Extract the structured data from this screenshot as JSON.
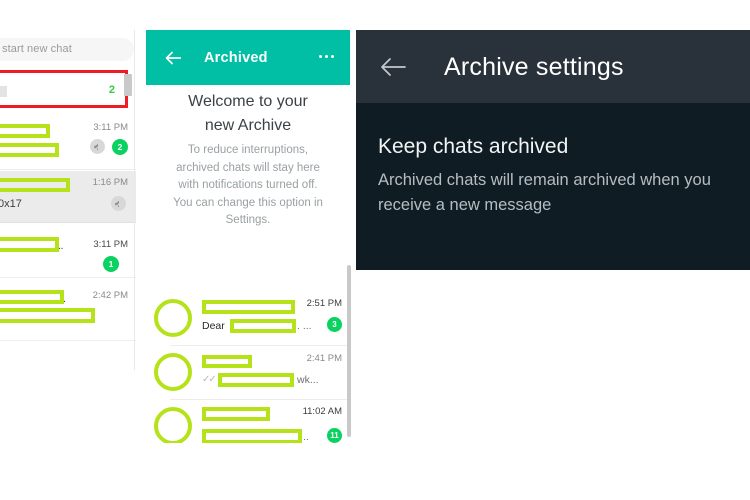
{
  "left_panel": {
    "name": "whatsapp-chat-list",
    "search": {
      "placeholder": "start new chat",
      "icon": "search-icon"
    },
    "archived_entry": {
      "label": "",
      "count": "2",
      "highlight_color": "#ee1c25"
    },
    "rows": [
      {
        "time": "3:11 PM",
        "unread": "2",
        "muted": true,
        "selected": false,
        "snippet_suffix": "",
        "redacted": true
      },
      {
        "time": "1:16 PM",
        "unread": "",
        "muted": true,
        "selected": true,
        "snippet_suffix": "0x17",
        "redacted": true
      },
      {
        "time": "3:11 PM",
        "unread": "1",
        "muted": false,
        "selected": false,
        "snippet_suffix": "..",
        "redacted": true
      },
      {
        "time": "2:42 PM",
        "unread": "",
        "muted": false,
        "selected": false,
        "snippet_suffix": ".",
        "redacted": true
      }
    ]
  },
  "mid_panel": {
    "header": {
      "title": "Archived",
      "back_icon": "arrow-left-icon",
      "menu_icon": "overflow-menu-icon",
      "accent_color": "#00bfa5"
    },
    "welcome": {
      "title_line1": "Welcome to your",
      "title_line2": "new Archive",
      "body": "To reduce interruptions, archived chats will stay here with notifications turned off. You can change this option in Settings."
    },
    "chats": [
      {
        "time": "2:51 PM",
        "unread": "3",
        "prefix": "Dear",
        "suffix": ". ...",
        "ticks": "",
        "avatar": "contact-avatar"
      },
      {
        "time": "2:41 PM",
        "unread": "",
        "prefix": "",
        "suffix": "wk...",
        "ticks": "✓✓",
        "avatar": "contact-avatar"
      },
      {
        "time": "11:02 AM",
        "unread": "11",
        "prefix": "",
        "suffix": "..",
        "ticks": "",
        "avatar": "contact-avatar"
      }
    ]
  },
  "right_panel": {
    "header": {
      "title": "Archive settings",
      "back_icon": "arrow-left-icon",
      "bg_color": "#29323b"
    },
    "body_bg_color": "#101c23",
    "setting": {
      "title": "Keep chats archived",
      "description": "Archived chats will remain archived when you receive a new message"
    }
  }
}
